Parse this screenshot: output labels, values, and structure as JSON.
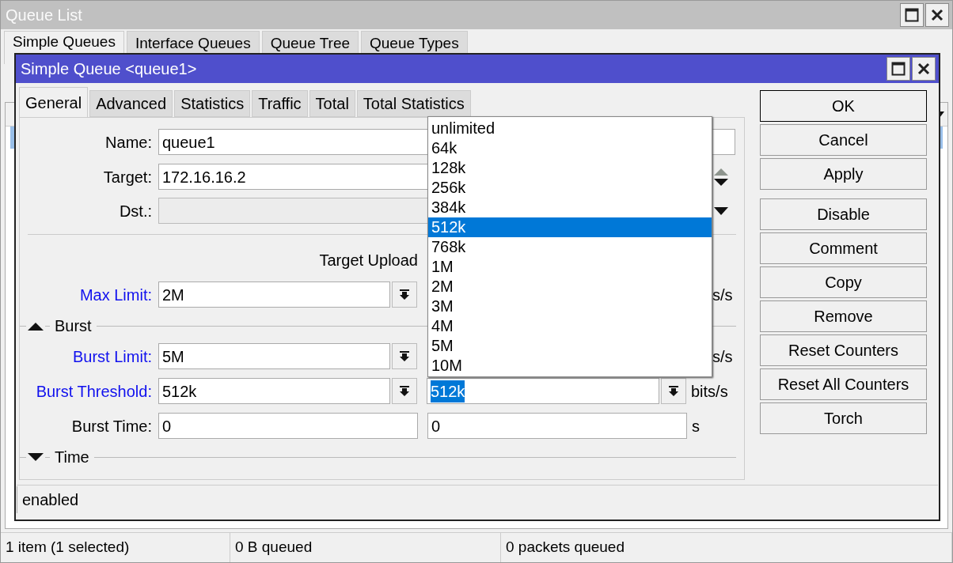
{
  "window": {
    "title": "Queue List"
  },
  "tabs": [
    {
      "label": "Simple Queues",
      "selected": true
    },
    {
      "label": "Interface Queues",
      "selected": false
    },
    {
      "label": "Queue Tree",
      "selected": false
    },
    {
      "label": "Queue Types",
      "selected": false
    }
  ],
  "list_rows": [
    {
      "selected": true
    }
  ],
  "dialog": {
    "title": "Simple Queue <queue1>",
    "tabs": [
      {
        "label": "General",
        "selected": true
      },
      {
        "label": "Advanced",
        "selected": false
      },
      {
        "label": "Statistics",
        "selected": false
      },
      {
        "label": "Traffic",
        "selected": false
      },
      {
        "label": "Total",
        "selected": false
      },
      {
        "label": "Total Statistics",
        "selected": false
      }
    ],
    "name": {
      "label": "Name:",
      "value": "queue1"
    },
    "target": {
      "label": "Target:",
      "value": "172.16.16.2"
    },
    "dst": {
      "label": "Dst.:",
      "disabled": true
    },
    "upload_header": "Target Upload",
    "max_limit": {
      "label": "Max Limit:",
      "upload": "2M",
      "unit": "s/s"
    },
    "burst_section": {
      "label": "Burst",
      "expanded": true
    },
    "burst_limit": {
      "label": "Burst Limit:",
      "upload": "5M",
      "unit": "s/s"
    },
    "burst_threshold": {
      "label": "Burst Threshold:",
      "upload": "512k",
      "download": "512k",
      "unit": "bits/s"
    },
    "burst_time": {
      "label": "Burst Time:",
      "upload": "0",
      "download": "0",
      "unit": "s"
    },
    "time_section": {
      "label": "Time",
      "expanded": false
    },
    "button_groups": [
      [
        {
          "label": "OK",
          "default": true
        },
        {
          "label": "Cancel",
          "default": false
        },
        {
          "label": "Apply",
          "default": false
        }
      ],
      [
        {
          "label": "Disable",
          "default": false
        },
        {
          "label": "Comment",
          "default": false
        },
        {
          "label": "Copy",
          "default": false
        },
        {
          "label": "Remove",
          "default": false
        },
        {
          "label": "Reset Counters",
          "default": false
        },
        {
          "label": "Reset All Counters",
          "default": false
        },
        {
          "label": "Torch",
          "default": false
        }
      ]
    ],
    "status": "enabled",
    "dropdown": [
      {
        "label": "unlimited",
        "selected": false
      },
      {
        "label": "64k",
        "selected": false
      },
      {
        "label": "128k",
        "selected": false
      },
      {
        "label": "256k",
        "selected": false
      },
      {
        "label": "384k",
        "selected": false
      },
      {
        "label": "512k",
        "selected": true
      },
      {
        "label": "768k",
        "selected": false
      },
      {
        "label": "1M",
        "selected": false
      },
      {
        "label": "2M",
        "selected": false
      },
      {
        "label": "3M",
        "selected": false
      },
      {
        "label": "4M",
        "selected": false
      },
      {
        "label": "5M",
        "selected": false
      },
      {
        "label": "10M",
        "selected": false
      }
    ]
  },
  "status_bar": [
    "1 item (1 selected)",
    "0 B queued",
    "0 packets queued"
  ]
}
